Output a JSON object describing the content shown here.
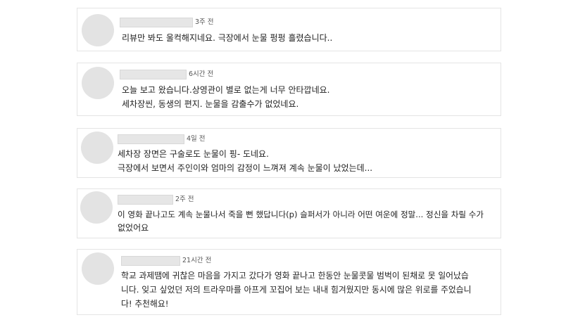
{
  "reviews": [
    {
      "time": "3주 전",
      "lines": [
        "리뷰만 봐도 울컥해지네요. 극장에서 눈물 펑펑 흘렸습니다.."
      ]
    },
    {
      "time": "6시간 전",
      "lines": [
        "오늘 보고 왔습니다.상영관이 별로 없는게 너무 안타깝네요.",
        "세차장씬, 동생의 편지. 눈물을 감출수가 없었네요."
      ]
    },
    {
      "time": "4일 전",
      "lines": [
        "세차장 장면은 구술로도 눈물이 핑- 도네요.",
        "극장에서 보면서 주인이와 엄마의 감정이 느껴져 계속 눈물이 났었는데..."
      ]
    },
    {
      "time": "2주 전",
      "lines": [
        "이 영화 끝나고도 계속 눈물나서 죽을 뻔 했답니다(p) 슬퍼서가 아니라 어떤 여운에 정말... 정신을 차릴 수가",
        "없었어요"
      ]
    },
    {
      "time": "21시간 전",
      "lines": [
        "학교 과제땜에 귀찮은 마음을 가지고 갔다가 영화 끝나고 한동안 눈물콧물 범벅이 된채로 못 일어났습",
        "니다. 잊고 싶었던 저의 트라우마를 아프게 꼬집어 보는 내내 힘겨웠지만 동시에 많은 위로를 주었습니",
        "다! 추천해요!"
      ]
    }
  ]
}
